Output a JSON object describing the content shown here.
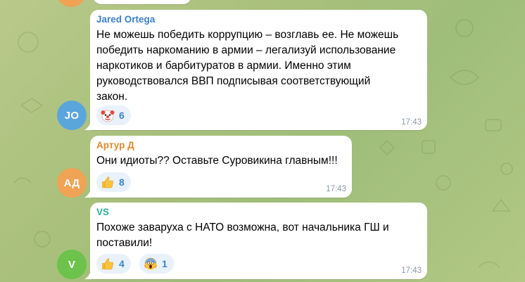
{
  "messages": [
    {
      "sender": "Jared Ortega",
      "sender_color": "#3d7fc7",
      "avatar_initials": "JO",
      "avatar_color": "#5aa5dc",
      "text": "Не можешь победить коррупцию – возглавь ее. Не можешь\nпобедить наркоманию в армии – легализуй использование\nнаркотиков и барбитуратов в армии. Именно этим\nруководствовался ВВП подписывая соответствующий\nзакон.",
      "reactions": [
        {
          "icon": "clown-face-icon",
          "count": "6"
        }
      ],
      "time": "17:43"
    },
    {
      "sender": "Артур Д",
      "sender_color": "#e08a2c",
      "avatar_initials": "АД",
      "avatar_color": "#f0a255",
      "text": "Они идиоты?? Оставьте Суровикина главным!!!",
      "reactions": [
        {
          "icon": "thumbs-up-icon",
          "count": "8"
        }
      ],
      "time": "17:43"
    },
    {
      "sender": "VS",
      "sender_color": "#2fae9b",
      "avatar_initials": "V",
      "avatar_color": "#6cc24a",
      "text": "Похоже заваруха с НАТО возможна, вот начальника ГШ и\nпоставили!",
      "reactions": [
        {
          "icon": "thumbs-up-icon",
          "count": "4"
        },
        {
          "icon": "screaming-face-icon",
          "count": "1"
        }
      ],
      "time": "17:43"
    }
  ]
}
